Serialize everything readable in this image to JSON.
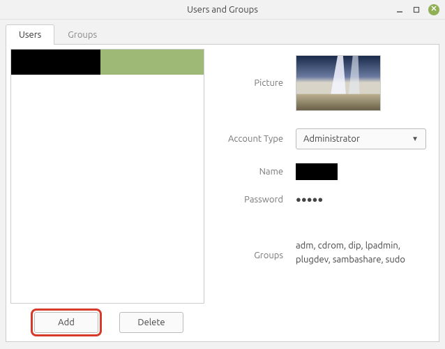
{
  "window": {
    "title": "Users and Groups"
  },
  "tabs": {
    "users": "Users",
    "groups": "Groups"
  },
  "buttons": {
    "add": "Add",
    "delete": "Delete"
  },
  "form": {
    "picture_label": "Picture",
    "account_type_label": "Account Type",
    "account_type_value": "Administrator",
    "name_label": "Name",
    "password_label": "Password",
    "password_value": "●●●●●",
    "groups_label": "Groups",
    "groups_value": "adm, cdrom, dip, lpadmin, plugdev, sambashare, sudo"
  }
}
